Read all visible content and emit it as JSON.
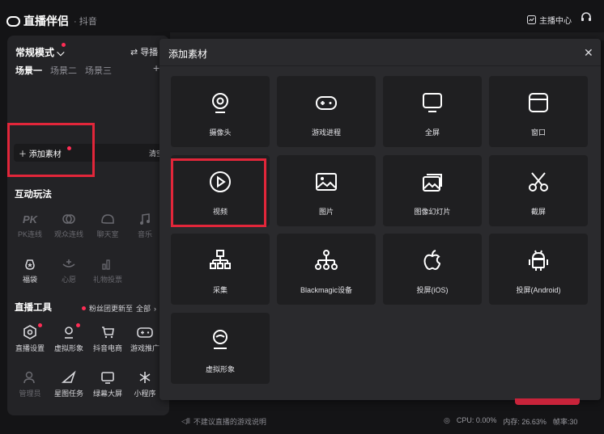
{
  "app": {
    "name": "直播伴侣",
    "platform": "· 抖音"
  },
  "header": {
    "anchor_center": "主播中心"
  },
  "left_panel": {
    "mode": "常规模式",
    "import": "导播",
    "scenes": [
      "场景一",
      "场景二",
      "场景三"
    ],
    "add_source": "添加素材",
    "clear": "清空",
    "interactive_title": "互动玩法",
    "interactive": [
      {
        "label": "PK连线",
        "icon": "pk-icon"
      },
      {
        "label": "观众连线",
        "icon": "link-icon"
      },
      {
        "label": "聊天室",
        "icon": "chatroom-icon"
      },
      {
        "label": "音乐",
        "icon": "music-icon"
      },
      {
        "label": "福袋",
        "icon": "lucky-bag-icon"
      },
      {
        "label": "心愿",
        "icon": "wish-icon"
      },
      {
        "label": "礼物投票",
        "icon": "gift-vote-icon"
      }
    ],
    "tools_title": "直播工具",
    "fans_note": "粉丝团更新至",
    "fans_all": "全部",
    "tools": [
      {
        "label": "直播设置",
        "icon": "settings-hex-icon"
      },
      {
        "label": "虚拟形象",
        "icon": "avatar-icon"
      },
      {
        "label": "抖音电商",
        "icon": "cart-icon"
      },
      {
        "label": "游戏推广",
        "icon": "gamepad-icon"
      },
      {
        "label": "管理员",
        "icon": "admin-icon"
      },
      {
        "label": "星图任务",
        "icon": "star-map-icon"
      },
      {
        "label": "绿幕大屏",
        "icon": "monitor-icon"
      },
      {
        "label": "小程序",
        "icon": "mini-program-icon"
      }
    ]
  },
  "modal": {
    "title": "添加素材",
    "items": [
      {
        "label": "摄像头",
        "icon": "camera-icon"
      },
      {
        "label": "游戏进程",
        "icon": "game-process-icon"
      },
      {
        "label": "全屏",
        "icon": "fullscreen-icon"
      },
      {
        "label": "窗口",
        "icon": "window-icon"
      },
      {
        "label": "视频",
        "icon": "video-icon"
      },
      {
        "label": "图片",
        "icon": "image-icon"
      },
      {
        "label": "图像幻灯片",
        "icon": "slideshow-icon"
      },
      {
        "label": "截屏",
        "icon": "scissors-icon"
      },
      {
        "label": "采集",
        "icon": "capture-icon"
      },
      {
        "label": "Blackmagic设备",
        "icon": "blackmagic-icon"
      },
      {
        "label": "投屏(iOS)",
        "icon": "apple-icon"
      },
      {
        "label": "投屏(Android)",
        "icon": "android-icon"
      },
      {
        "label": "虚拟形象",
        "icon": "virtual-avatar-icon"
      }
    ]
  },
  "status": {
    "note": "不建议直播的游戏说明",
    "cpu": "CPU: 0.00%",
    "memory": "内存: 26.63%",
    "fps": "帧率:30"
  },
  "colors": {
    "accent_red": "#e2263a",
    "badge_red": "#ff2d55",
    "background": "#141416"
  }
}
